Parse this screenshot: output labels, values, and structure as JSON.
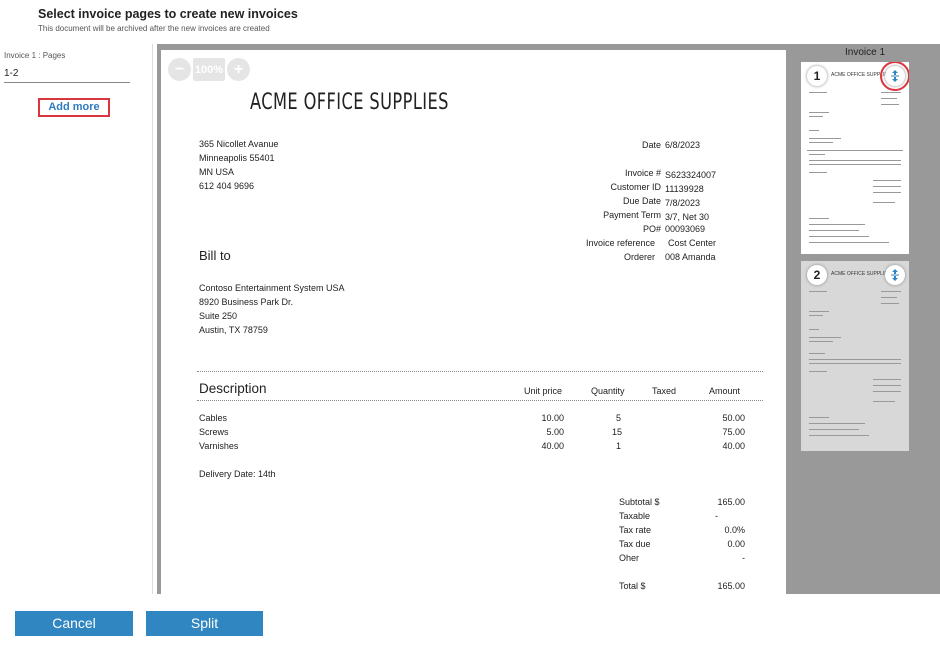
{
  "header": {
    "title": "Select invoice pages to create new invoices",
    "subtitle": "This document will be archived after the new invoices are created"
  },
  "left_panel": {
    "field_label": "Invoice 1 : Pages",
    "field_value": "1-2",
    "add_more_label": "Add more"
  },
  "viewer": {
    "zoom_minus": "−",
    "zoom_level": "100%",
    "zoom_plus": "+"
  },
  "invoice": {
    "company": "ACME OFFICE SUPPLIES",
    "address": [
      "365 Nicollet Avanue",
      "Minneapolis 55401",
      "MN USA",
      "612 404 9696"
    ],
    "date_label": "Date",
    "date_value": "6/8/2023",
    "meta": [
      {
        "label": "Invoice #",
        "value": "S623324007"
      },
      {
        "label": "Customer ID",
        "value": "11139928"
      },
      {
        "label": "Due Date",
        "value": "7/8/2023"
      },
      {
        "label": "Payment Term",
        "value": "3/7, Net 30"
      },
      {
        "label": "PO#",
        "value": "00093069"
      },
      {
        "label": "Invoice reference",
        "value": "Cost Center"
      },
      {
        "label": "Orderer",
        "value": "008 Amanda"
      }
    ],
    "bill_to_label": "Bill to",
    "bill_to": [
      "Contoso Entertainment System USA",
      "8920 Business Park Dr.",
      "Suite 250",
      "Austin, TX 78759"
    ],
    "table_headers": {
      "description": "Description",
      "unit_price": "Unit price",
      "quantity": "Quantity",
      "taxed": "Taxed",
      "amount": "Amount"
    },
    "items": [
      {
        "description": "Cables",
        "unit_price": "10.00",
        "quantity": "5",
        "amount": "50.00"
      },
      {
        "description": "Screws",
        "unit_price": "5.00",
        "quantity": "15",
        "amount": "75.00"
      },
      {
        "description": "Varnishes",
        "unit_price": "40.00",
        "quantity": "1",
        "amount": "40.00"
      }
    ],
    "delivery_note": "Delivery Date: 14th",
    "totals": [
      {
        "label": "Subtotal $",
        "value": "165.00"
      },
      {
        "label": "Taxable",
        "value": "-"
      },
      {
        "label": "Tax rate",
        "value": "0.0%"
      },
      {
        "label": "Tax due",
        "value": "0.00"
      },
      {
        "label": "Oher",
        "value": "-"
      }
    ],
    "total_label": "Total $",
    "total_value": "165.00"
  },
  "thumbnails": {
    "title": "Invoice 1",
    "pages": [
      {
        "number": "1",
        "title": "ACME OFFICE SUPPLIES"
      },
      {
        "number": "2",
        "title": "ACME OFFICE SUPPLIES"
      }
    ]
  },
  "footer": {
    "cancel_label": "Cancel",
    "split_label": "Split"
  },
  "colors": {
    "accent": "#2f86c0",
    "highlight": "#d9363e",
    "viewer_bg": "#999999"
  }
}
